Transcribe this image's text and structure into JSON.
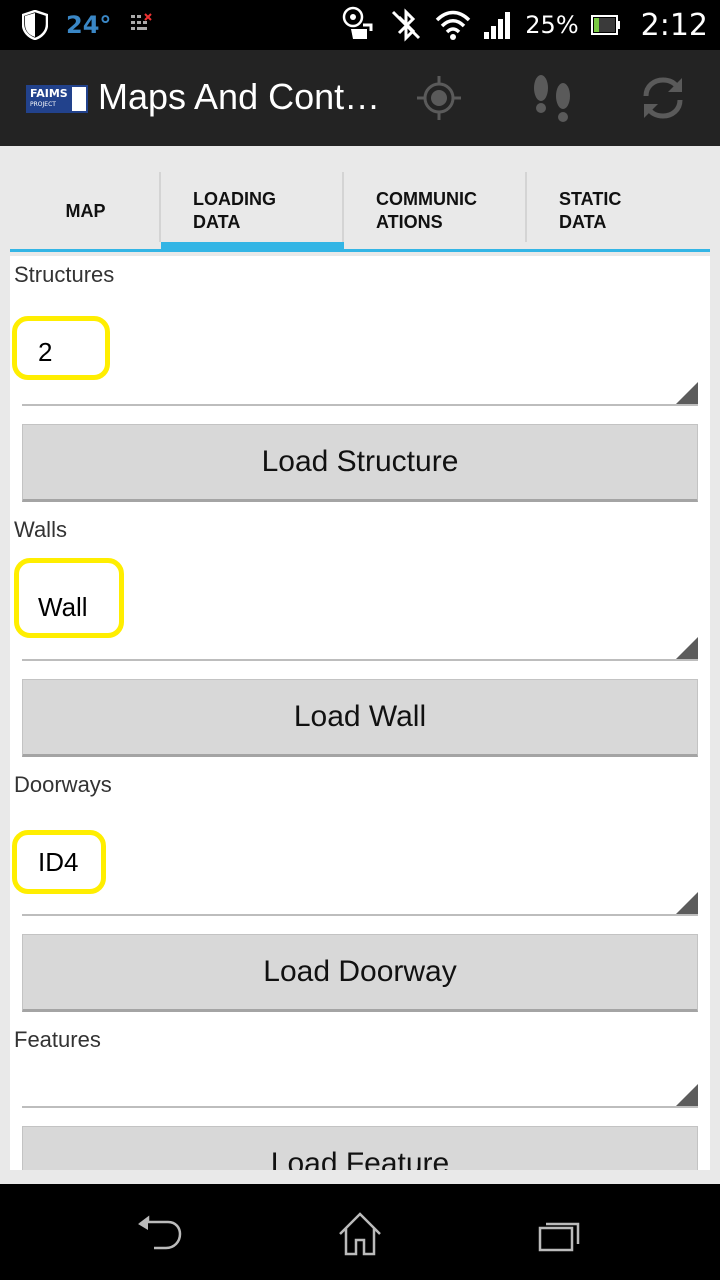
{
  "status": {
    "temperature": "24°",
    "battery_percent": "25%",
    "time": "2:12",
    "icons": [
      "shield-icon",
      "temperature-icon",
      "keyboard-icon",
      "usb-debug-icon",
      "bluetooth-off-icon",
      "wifi-icon",
      "signal-icon",
      "battery-icon"
    ]
  },
  "app": {
    "logo_text": "FAIMS",
    "logo_subtext": "PROJECT",
    "title": "Maps And Cont…",
    "actions": [
      "gps-target-icon",
      "footsteps-icon",
      "sync-icon"
    ]
  },
  "tabs": [
    {
      "label": "MAP",
      "active": false
    },
    {
      "label": "LOADING\nDATA",
      "active": true
    },
    {
      "label": "COMMUNIC\nATIONS",
      "active": false
    },
    {
      "label": "STATIC\nDATA",
      "active": false
    }
  ],
  "sections": {
    "structures": {
      "label": "Structures",
      "value": "2",
      "button": "Load Structure"
    },
    "walls": {
      "label": "Walls",
      "value": "Wall",
      "button": "Load Wall"
    },
    "doorways": {
      "label": "Doorways",
      "value": "ID4",
      "button": "Load Doorway"
    },
    "features": {
      "label": "Features",
      "value": "",
      "button": "Load Feature"
    }
  },
  "colors": {
    "accent": "#33b5e5",
    "highlight": "#ffee00",
    "actionbar": "#232323"
  },
  "nav": [
    "back-icon",
    "home-icon",
    "recent-apps-icon"
  ]
}
